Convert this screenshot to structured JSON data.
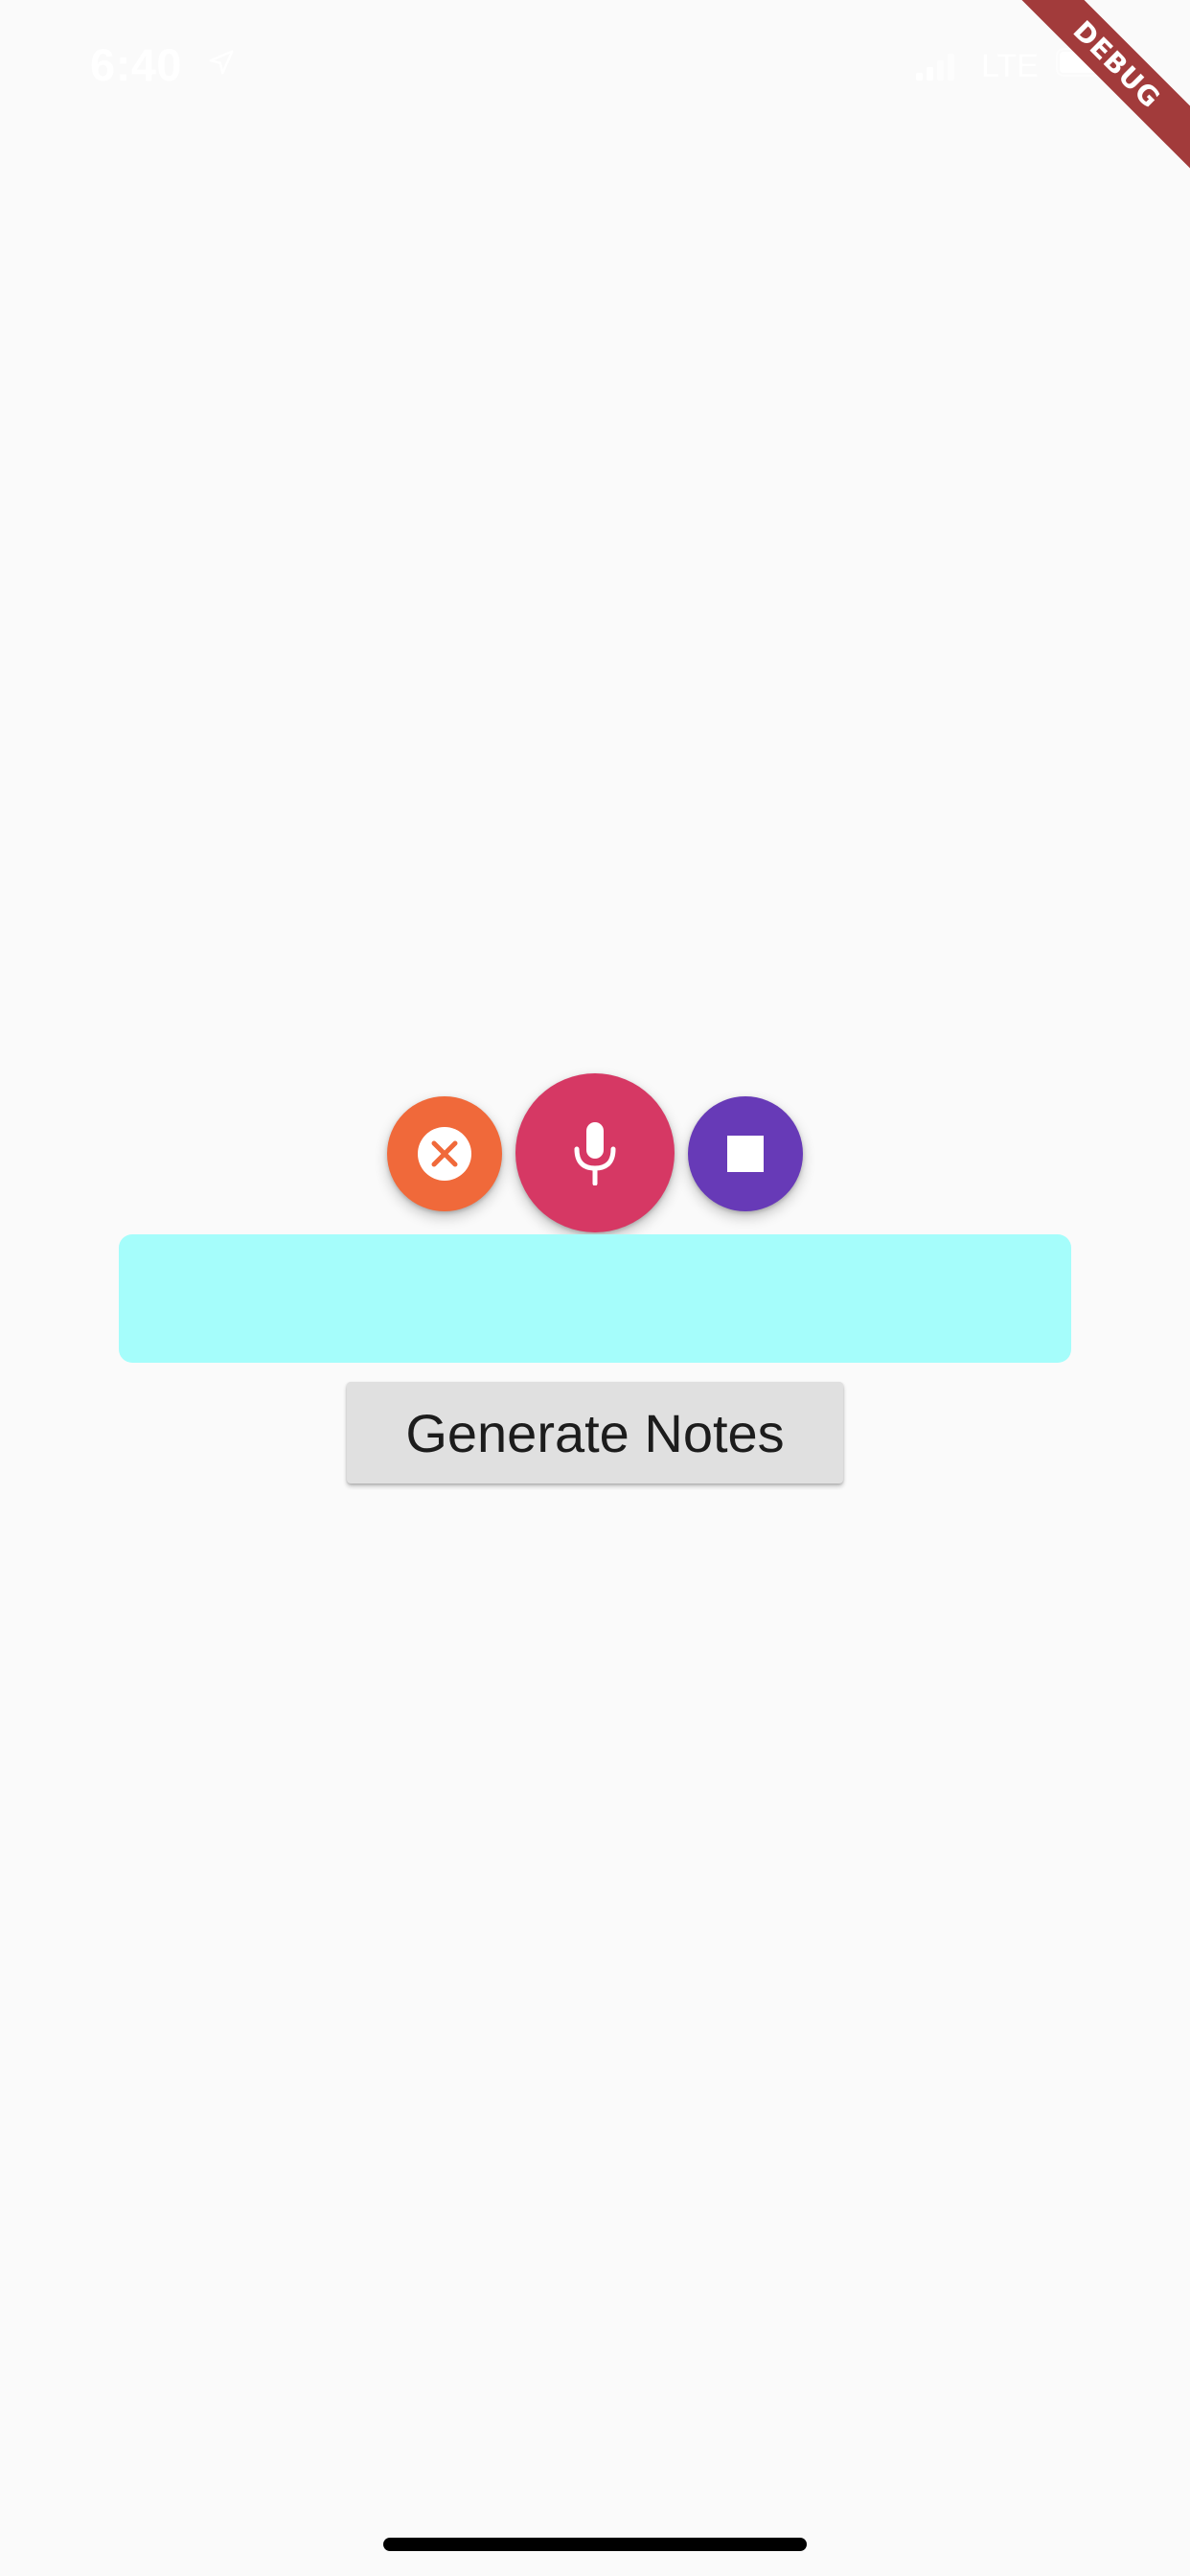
{
  "status_bar": {
    "time": "6:40",
    "network": "LTE",
    "location_icon": "location-arrow-icon",
    "signal_icon": "cellular-signal-icon",
    "battery_icon": "battery-icon"
  },
  "debug_banner": {
    "label": "DEBUG",
    "color": "#a23b3b"
  },
  "controls": {
    "cancel": {
      "icon": "close-circle-icon",
      "color": "#f0693a"
    },
    "mic": {
      "icon": "microphone-icon",
      "color": "#d63864"
    },
    "stop": {
      "icon": "stop-icon",
      "color": "#673ab7"
    }
  },
  "notes_box": {
    "text": "",
    "background": "#a5fdfb"
  },
  "generate_button": {
    "label": "Generate Notes"
  }
}
